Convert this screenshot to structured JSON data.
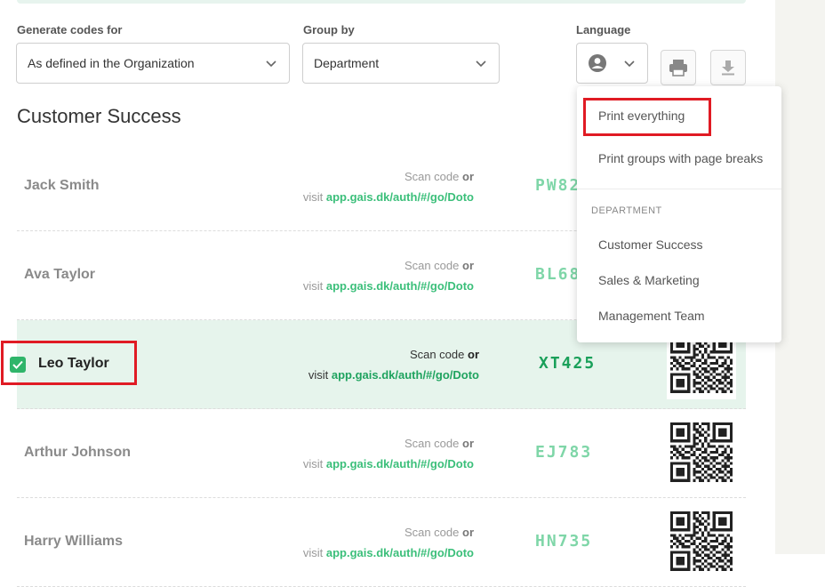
{
  "filters": {
    "generate_label": "Generate codes for",
    "generate_value": "As defined in the Organization",
    "group_label": "Group by",
    "group_value": "Department",
    "language_label": "Language"
  },
  "section_title": "Customer Success",
  "rows": [
    {
      "name": "Jack Smith",
      "scan": "Scan code",
      "or": "or",
      "visit": "visit",
      "link": "app.gais.dk/auth/#/go/Doto",
      "code": "PW82"
    },
    {
      "name": "Ava Taylor",
      "scan": "Scan code",
      "or": "or",
      "visit": "visit",
      "link": "app.gais.dk/auth/#/go/Doto",
      "code": "BL68"
    },
    {
      "name": "Leo Taylor",
      "scan": "Scan code",
      "or": "or",
      "visit": "visit",
      "link": "app.gais.dk/auth/#/go/Doto",
      "code": "XT425",
      "selected": true
    },
    {
      "name": "Arthur Johnson",
      "scan": "Scan code",
      "or": "or",
      "visit": "visit",
      "link": "app.gais.dk/auth/#/go/Doto",
      "code": "EJ783"
    },
    {
      "name": "Harry Williams",
      "scan": "Scan code",
      "or": "or",
      "visit": "visit",
      "link": "app.gais.dk/auth/#/go/Doto",
      "code": "HN735"
    }
  ],
  "dropdown": {
    "print_everything": "Print everything",
    "print_groups": "Print groups with page breaks",
    "heading": "DEPARTMENT",
    "departments": [
      "Customer Success",
      "Sales & Marketing",
      "Management Team"
    ]
  },
  "icons": {
    "language": "user-circle-icon",
    "print": "printer-icon",
    "download": "download-icon",
    "chevron": "chevron-down-icon",
    "check": "check-icon",
    "qr": "qr-code-icon"
  },
  "colors": {
    "accent_green": "#2fb56a",
    "link_green": "#3bbf7a",
    "selected_row": "#e6f4ec",
    "highlight_red": "#e01b24"
  }
}
